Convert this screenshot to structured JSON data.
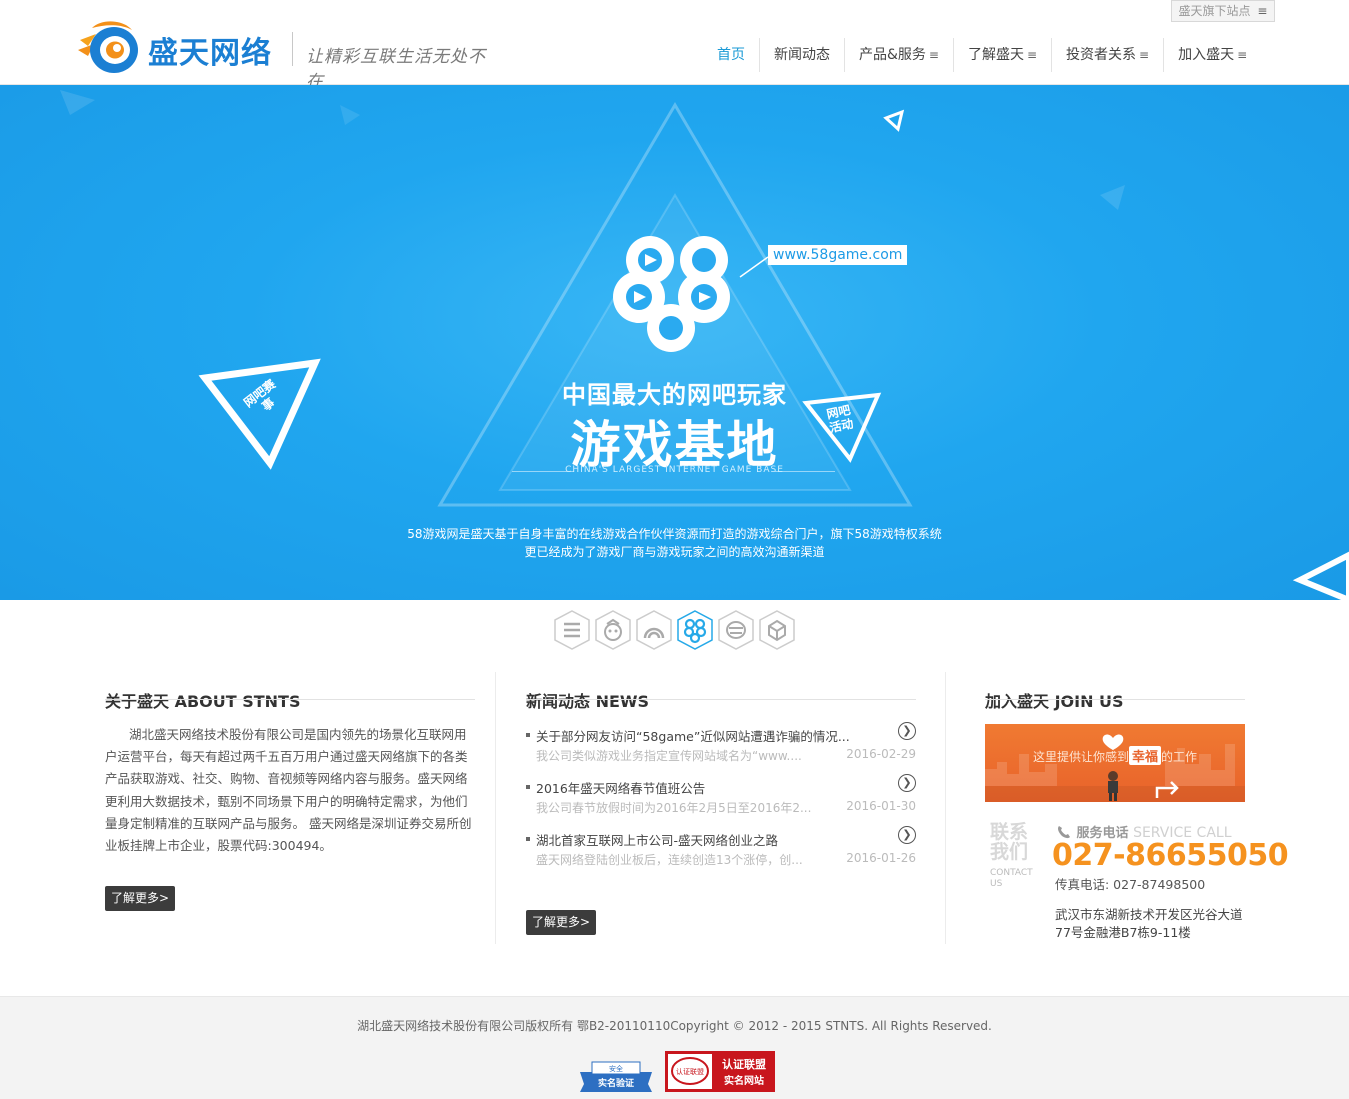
{
  "header": {
    "subsites_label": "盛天旗下站点",
    "logo_name": "盛天网络",
    "slogan": "让精彩互联生活无处不在",
    "nav": [
      {
        "label": "首页",
        "dropdown": false
      },
      {
        "label": "新闻动态",
        "dropdown": false
      },
      {
        "label": "产品&服务",
        "dropdown": true
      },
      {
        "label": "了解盛天",
        "dropdown": true
      },
      {
        "label": "投资者关系",
        "dropdown": true
      },
      {
        "label": "加入盛天",
        "dropdown": true
      }
    ],
    "nav_menu_glyph": "≡",
    "accent_color": "#1a9ad6"
  },
  "banner": {
    "url_badge": "www.58game.com",
    "headline": "中国最大的网吧玩家",
    "title": "游戏基地",
    "subtitle_en": "CHINA'S LARGEST INTERNET GAME BASE",
    "left_triangle_label": "网吧赛事",
    "right_triangle_label": "网吧活动",
    "description_line1": "58游戏网是盛天基于自身丰富的在线游戏合作伙伴资源而打造的游戏综合门户，旗下58游戏特权系统",
    "description_line2": "更已经成为了游戏厂商与游戏玩家之间的高效沟通新渠道",
    "background_color": "#20a6ef"
  },
  "thumbnails": {
    "icons": [
      "menu-lines-icon",
      "mascot-icon",
      "arch-icon",
      "game-58-icon",
      "layers-icon",
      "cube-icon"
    ],
    "active_index": 3
  },
  "about": {
    "title": "关于盛天 ABOUT STNTS",
    "text": "湖北盛天网络技术股份有限公司是国内领先的场景化互联网用户运营平台，每天有超过两千五百万用户通过盛天网络旗下的各类产品获取游戏、社交、购物、音视频等网络内容与服务。盛天网络更利用大数据技术，甄别不同场景下用户的明确特定需求，为他们量身定制精准的互联网产品与服务。 盛天网络是深圳证券交易所创业板挂牌上市企业，股票代码:300494。",
    "more_label": "了解更多>"
  },
  "news": {
    "title": "新闻动态 NEWS",
    "items": [
      {
        "title": "关于部分网友访问“58game”近似网站遭遇诈骗的情况...",
        "summary": "我公司类似游戏业务指定宣传网站域名为“www....",
        "date": "2016-02-29"
      },
      {
        "title": "2016年盛天网络春节值班公告",
        "summary": "我公司春节放假时间为2016年2月5日至2016年2...",
        "date": "2016-01-30"
      },
      {
        "title": "湖北首家互联网上市公司-盛天网络创业之路",
        "summary": "盛天网络登陆创业板后，连续创造13个涨停，创...",
        "date": "2016-01-26"
      }
    ],
    "more_label": "了解更多>"
  },
  "join": {
    "title": "加入盛天 JOIN US",
    "banner_text_before": "这里提供让你感到",
    "banner_text_highlight": "幸福",
    "banner_text_after": "的工作",
    "contact_cn": "联系我们",
    "contact_en": "CONTACT US",
    "service_label_cn": "服务电话",
    "service_label_en": "SERVICE CALL",
    "phone": "027-86655050",
    "fax": "传真电话: 027-87498500",
    "address": "武汉市东湖新技术开发区光谷大道77号金融港B7栋9-11楼",
    "banner_color": "#ec6e2e",
    "phone_color": "#f5921f"
  },
  "footer": {
    "copyright": "湖北盛天网络技术股份有限公司版权所有 鄂B2-20110110Copyright © 2012 - 2015 STNTS. All Rights Reserved.",
    "cert1_top": "安全",
    "cert1_mid": "联盟",
    "cert1_bottom": "实名验证",
    "cert2_title": "认证联盟",
    "cert2_sub": "实名网站",
    "cert2_seal": "认证联盟"
  }
}
